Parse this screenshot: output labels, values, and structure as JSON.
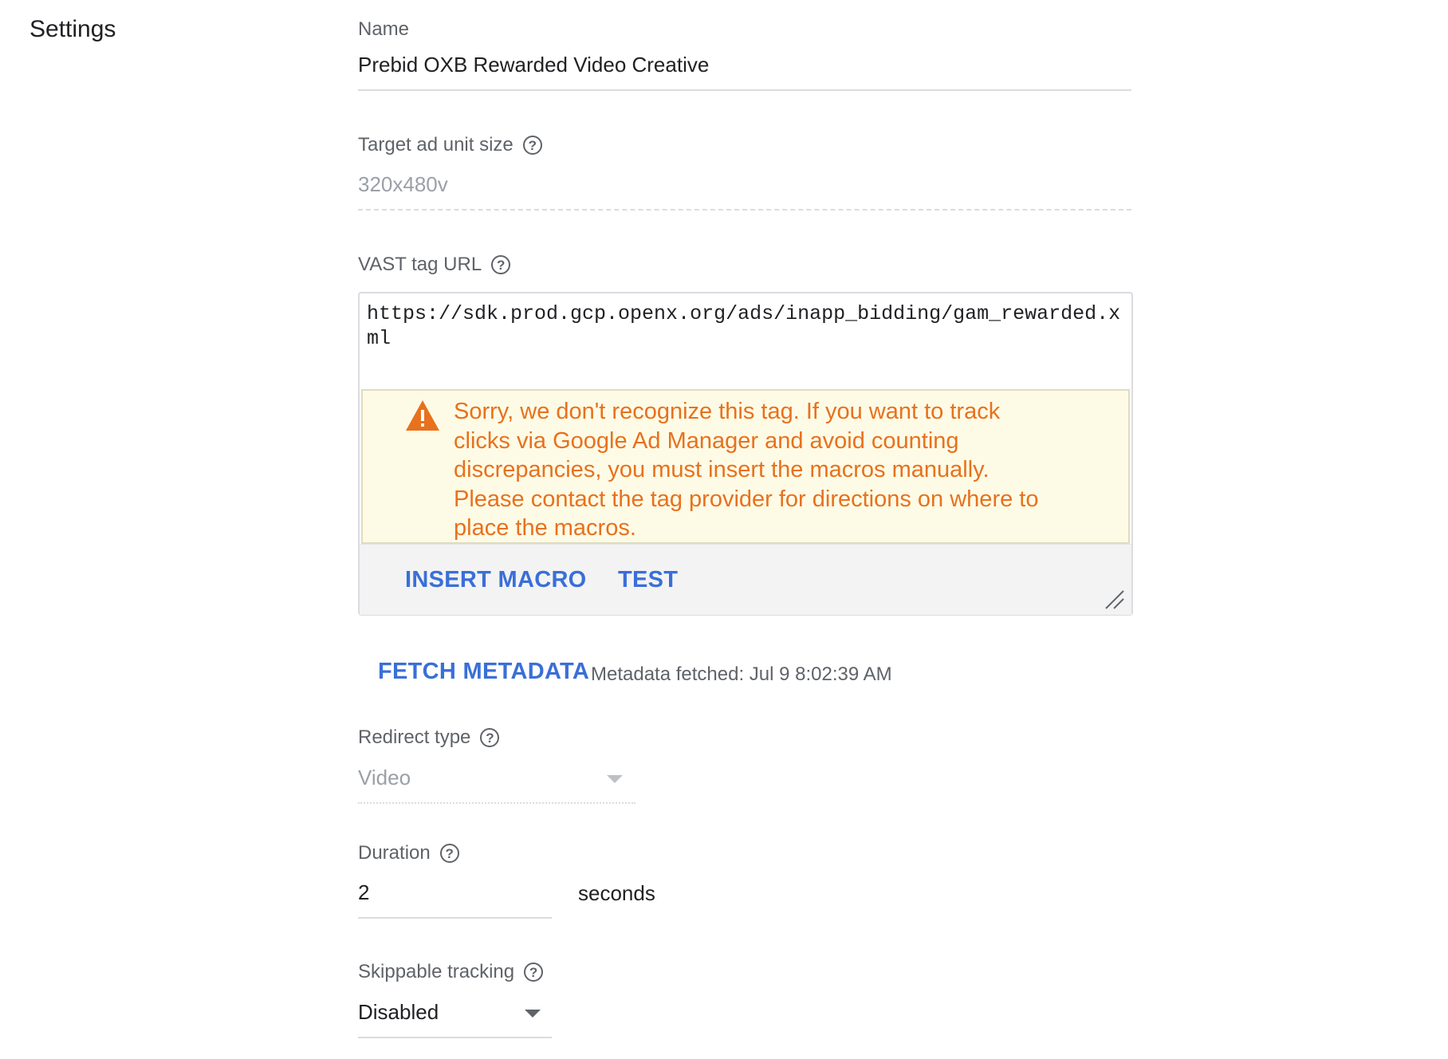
{
  "section": {
    "title": "Settings"
  },
  "fields": {
    "name": {
      "label": "Name",
      "value": "Prebid OXB Rewarded Video Creative"
    },
    "target_ad_unit_size": {
      "label": "Target ad unit size",
      "value": "320x480v",
      "help_icon": "help-icon"
    },
    "vast_tag_url": {
      "label": "VAST tag URL",
      "value": "https://sdk.prod.gcp.openx.org/ads/inapp_bidding/gam_rewarded.xml",
      "help_icon": "help-icon",
      "warning": {
        "icon": "warning-icon",
        "text": "Sorry, we don't recognize this tag. If you want to track clicks via Google Ad Manager and avoid counting discrepancies, you must insert the macros manually. Please contact the tag provider for directions on where to place the macros."
      },
      "toolbar": {
        "insert_macro_label": "INSERT MACRO",
        "test_label": "TEST"
      }
    },
    "metadata": {
      "fetch_label": "FETCH METADATA",
      "status": "Metadata fetched: Jul 9 8:02:39 AM"
    },
    "redirect_type": {
      "label": "Redirect type",
      "value": "Video",
      "help_icon": "help-icon"
    },
    "duration": {
      "label": "Duration",
      "value": "2",
      "unit": "seconds",
      "help_icon": "help-icon"
    },
    "skippable_tracking": {
      "label": "Skippable tracking",
      "value": "Disabled",
      "help_icon": "help-icon"
    }
  },
  "colors": {
    "accent": "#3a6fd8",
    "warning_text": "#e8711d",
    "warning_bg": "#fdfbe6",
    "label": "#5f6368"
  }
}
